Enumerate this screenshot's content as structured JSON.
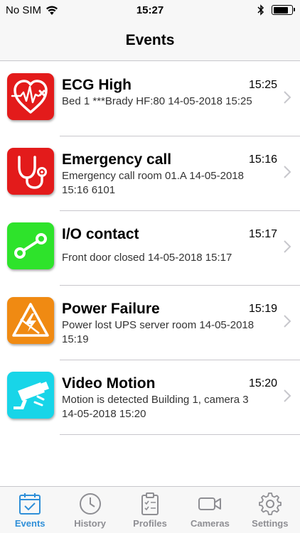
{
  "status_bar": {
    "carrier": "No SIM",
    "time": "15:27",
    "wifi_icon": "wifi-icon",
    "bluetooth_icon": "bluetooth-icon",
    "battery_level": 0.8
  },
  "header": {
    "title": "Events"
  },
  "events": [
    {
      "title": "ECG High",
      "time": "15:25",
      "description": "Bed 1 ***Brady HF:80 14-05-2018 15:25",
      "icon": "heart-ecg-icon",
      "color": "#e31b1b"
    },
    {
      "title": "Emergency call",
      "time": "15:16",
      "description": "Emergency call room 01.A 14-05-2018 15:16 6101",
      "icon": "stethoscope-icon",
      "color": "#e31b1b"
    },
    {
      "title": "I/O contact",
      "time": "15:17",
      "description": "Front door closed 14-05-2018 15:17",
      "icon": "io-contact-icon",
      "color": "#2ee32b"
    },
    {
      "title": "Power Failure",
      "time": "15:19",
      "description": "Power lost UPS server room 14-05-2018 15:19",
      "icon": "power-warning-icon",
      "color": "#f08a12"
    },
    {
      "title": "Video Motion",
      "time": "15:20",
      "description": "Motion is detected Building 1, camera 3 14-05-2018 15:20",
      "icon": "camera-motion-icon",
      "color": "#18d5e8"
    }
  ],
  "tabs": [
    {
      "label": "Events",
      "icon": "calendar-check-icon",
      "active": true
    },
    {
      "label": "History",
      "icon": "clock-icon",
      "active": false
    },
    {
      "label": "Profiles",
      "icon": "clipboard-icon",
      "active": false
    },
    {
      "label": "Cameras",
      "icon": "video-camera-icon",
      "active": false
    },
    {
      "label": "Settings",
      "icon": "gear-icon",
      "active": false
    }
  ],
  "colors": {
    "accent": "#2f8fd8",
    "inactive": "#8e8e93"
  }
}
